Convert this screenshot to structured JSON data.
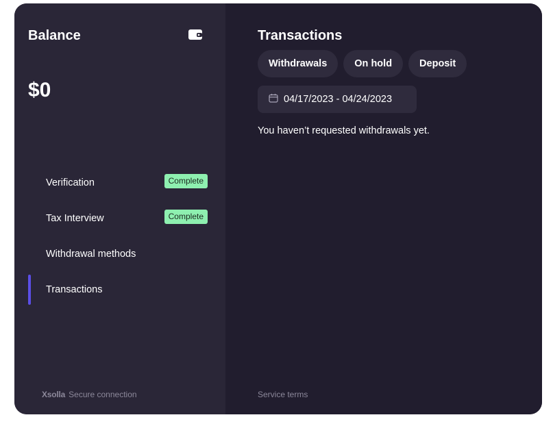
{
  "sidebar": {
    "title": "Balance",
    "amount": "$0",
    "wallet_icon": "wallet-icon",
    "items": [
      {
        "label": "Verification",
        "badge": "Complete"
      },
      {
        "label": "Tax Interview",
        "badge": "Complete"
      },
      {
        "label": "Withdrawal methods"
      },
      {
        "label": "Transactions",
        "active": true
      }
    ],
    "footer": {
      "brand": "Xsolla",
      "secure_label": "Secure connection"
    }
  },
  "main": {
    "title": "Transactions",
    "tabs": [
      {
        "label": "Withdrawals"
      },
      {
        "label": "On hold"
      },
      {
        "label": "Deposit"
      }
    ],
    "date_range": {
      "icon": "calendar-icon",
      "value": "04/17/2023 - 04/24/2023"
    },
    "empty_message": "You haven’t requested withdrawals yet.",
    "service_terms": "Service terms"
  },
  "colors": {
    "sidebar_bg": "#2a2637",
    "main_bg": "#211d2e",
    "badge_bg": "#8ef0b0",
    "accent": "#5b4ee6",
    "chip_bg": "#2f2b3d"
  }
}
